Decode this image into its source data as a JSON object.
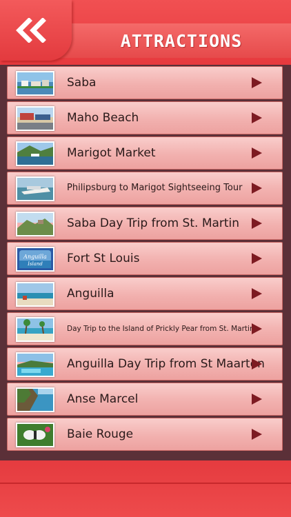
{
  "header": {
    "title": "ATTRACTIONS",
    "back_icon": "double-chevron-left-icon"
  },
  "colors": {
    "header_red": "#e6393d",
    "panel_dark": "#5b3038",
    "row_pink": "#f2b1af",
    "chevron": "#7d1b22"
  },
  "items": [
    {
      "label": "Saba",
      "icon": "chevron-right-icon"
    },
    {
      "label": "Maho Beach",
      "icon": "chevron-right-icon"
    },
    {
      "label": "Marigot Market",
      "icon": "chevron-right-icon"
    },
    {
      "label": "Philipsburg to Marigot Sightseeing Tour",
      "icon": "chevron-right-icon"
    },
    {
      "label": "Saba Day Trip from St. Martin",
      "icon": "chevron-right-icon"
    },
    {
      "label": "Fort St Louis",
      "icon": "chevron-right-icon"
    },
    {
      "label": "Anguilla",
      "icon": "chevron-right-icon"
    },
    {
      "label": "Day Trip to the Island of Prickly Pear from St. Martin",
      "icon": "chevron-right-icon"
    },
    {
      "label": "Anguilla Day Trip from St Maarten",
      "icon": "chevron-right-icon"
    },
    {
      "label": "Anse Marcel",
      "icon": "chevron-right-icon"
    },
    {
      "label": "Baie Rouge",
      "icon": "chevron-right-icon"
    }
  ],
  "thumb_logo_text": "Anguilla Island"
}
